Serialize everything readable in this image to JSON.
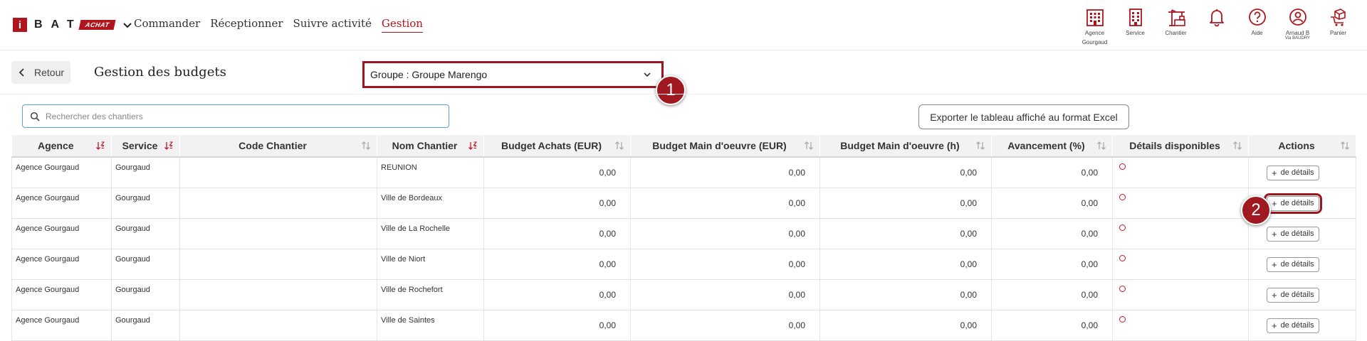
{
  "header": {
    "logo": {
      "i": "i",
      "letters": "BAT",
      "badge": "ACHAT"
    },
    "nav": [
      {
        "label": "Commander",
        "active": false
      },
      {
        "label": "Réceptionner",
        "active": false
      },
      {
        "label": "Suivre activité",
        "active": false
      },
      {
        "label": "Gestion",
        "active": true
      }
    ],
    "icons": [
      {
        "icon": "building-icon",
        "label": "Agence",
        "label2": "Gourgaud"
      },
      {
        "icon": "service-building-icon",
        "label": "Service",
        "label2": ""
      },
      {
        "icon": "crane-icon",
        "label": "Chantier",
        "label2": ""
      },
      {
        "icon": "bell-icon",
        "label": "",
        "label2": ""
      },
      {
        "icon": "help-icon",
        "label": "Aide",
        "label2": ""
      },
      {
        "icon": "user-icon",
        "label": "Arnaud B",
        "label2": "Via BAUDRY"
      },
      {
        "icon": "cart-icon",
        "label": "Panier",
        "label2": ""
      }
    ],
    "accent_color": "#b0141c"
  },
  "toolbar": {
    "back_label": "Retour",
    "page_title": "Gestion des budgets",
    "group_select_value": "Groupe : Groupe Marengo",
    "callout_1": "1",
    "callout_2": "2",
    "search_placeholder": "Rechercher des chantiers",
    "export_label": "Exporter le tableau affiché au format Excel"
  },
  "table": {
    "columns": [
      {
        "label": "Agence",
        "sort": "active"
      },
      {
        "label": "Service",
        "sort": "active"
      },
      {
        "label": "Code Chantier",
        "sort": "none"
      },
      {
        "label": "Nom Chantier",
        "sort": "active"
      },
      {
        "label": "Budget Achats (EUR)",
        "sort": "none"
      },
      {
        "label": "Budget Main d'oeuvre (EUR)",
        "sort": "none"
      },
      {
        "label": "Budget Main d'oeuvre (h)",
        "sort": "none"
      },
      {
        "label": "Avancement (%)",
        "sort": "none"
      },
      {
        "label": "Détails disponibles",
        "sort": "none"
      },
      {
        "label": "Actions",
        "sort": "none"
      }
    ],
    "rows": [
      {
        "agence": "Agence Gourgaud",
        "service": "Gourgaud",
        "code": "",
        "nom": "REUNION",
        "achats": "0,00",
        "mo_eur": "0,00",
        "mo_h": "0,00",
        "avancement": "0,00",
        "action": "de détails"
      },
      {
        "agence": "Agence Gourgaud",
        "service": "Gourgaud",
        "code": "",
        "nom": "Ville de Bordeaux",
        "achats": "0,00",
        "mo_eur": "0,00",
        "mo_h": "0,00",
        "avancement": "0,00",
        "action": "de détails"
      },
      {
        "agence": "Agence Gourgaud",
        "service": "Gourgaud",
        "code": "",
        "nom": "Ville de La Rochelle",
        "achats": "0,00",
        "mo_eur": "0,00",
        "mo_h": "0,00",
        "avancement": "0,00",
        "action": "de détails"
      },
      {
        "agence": "Agence Gourgaud",
        "service": "Gourgaud",
        "code": "",
        "nom": "Ville de Niort",
        "achats": "0,00",
        "mo_eur": "0,00",
        "mo_h": "0,00",
        "avancement": "0,00",
        "action": "de détails"
      },
      {
        "agence": "Agence Gourgaud",
        "service": "Gourgaud",
        "code": "",
        "nom": "Ville de Rochefort",
        "achats": "0,00",
        "mo_eur": "0,00",
        "mo_h": "0,00",
        "avancement": "0,00",
        "action": "de détails"
      },
      {
        "agence": "Agence Gourgaud",
        "service": "Gourgaud",
        "code": "",
        "nom": "Ville de Saintes",
        "achats": "0,00",
        "mo_eur": "0,00",
        "mo_h": "0,00",
        "avancement": "0,00",
        "action": "de détails"
      }
    ],
    "details_status_color": "#c0192a"
  }
}
